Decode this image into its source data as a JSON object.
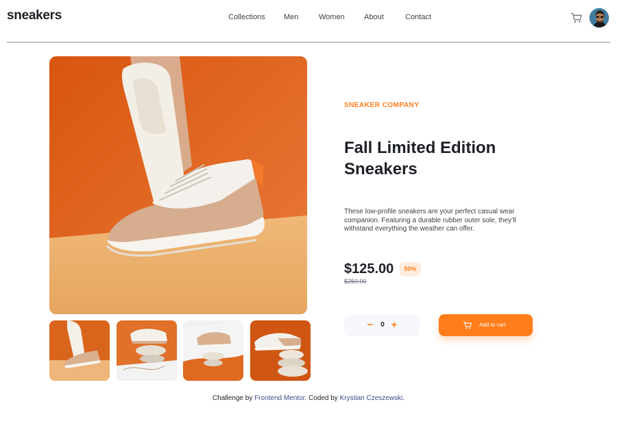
{
  "brand": {
    "logo_text": "sneakers"
  },
  "nav": {
    "items": [
      {
        "label": "Collections"
      },
      {
        "label": "Men"
      },
      {
        "label": "Women"
      },
      {
        "label": "About"
      },
      {
        "label": "Contact"
      }
    ]
  },
  "header": {
    "cart_icon": "cart-icon",
    "avatar_icon": "user-avatar"
  },
  "gallery": {
    "thumbnails": [
      {
        "name": "product-thumbnail-1"
      },
      {
        "name": "product-thumbnail-2"
      },
      {
        "name": "product-thumbnail-3"
      },
      {
        "name": "product-thumbnail-4"
      }
    ]
  },
  "product": {
    "company": "SNEAKER COMPANY",
    "title": "Fall Limited Edition Sneakers",
    "description": "These low-profile sneakers are your perfect casual wear companion. Featuring a durable rubber outer sole, they’ll withstand everything the weather can offer.",
    "price": "$125.00",
    "discount": "50%",
    "old_price": "$250.00"
  },
  "cart": {
    "quantity": "0",
    "minus_label": "−",
    "plus_label": "+",
    "add_label": "Add to cart"
  },
  "footer": {
    "prefix": "Challenge by ",
    "mentor_link": "Frontend Mentor",
    "middle": ". Coded by ",
    "author_link": "Krystian Czeszewski",
    "suffix": "."
  },
  "colors": {
    "accent": "#ff7d1a",
    "accent_pale": "#ffede0",
    "text_dark": "#1d2026",
    "text_muted": "#68707d",
    "stepper_bg": "#f6f8fd"
  }
}
